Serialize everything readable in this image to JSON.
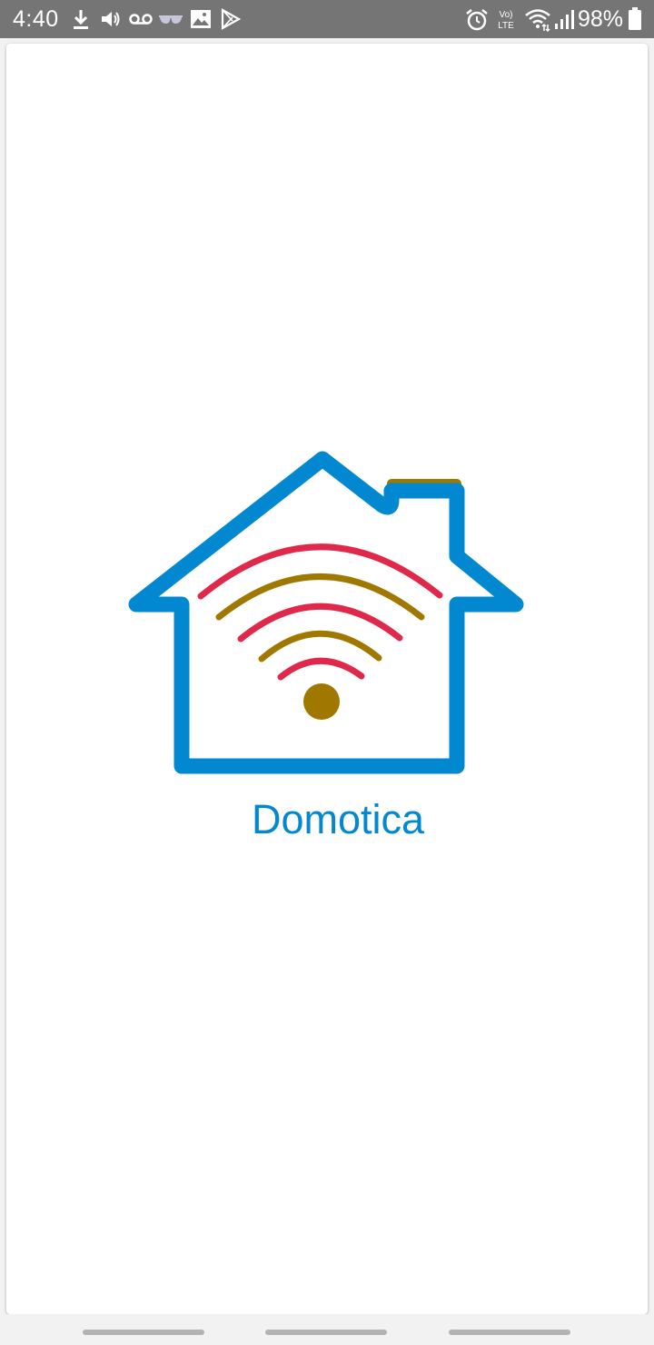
{
  "status_bar": {
    "time": "4:40",
    "battery_percent": "98%",
    "network_label": "Vo) LTE",
    "left_icons": [
      "download-icon",
      "volume-icon",
      "voicemail-icon",
      "glasses-icon",
      "image-icon",
      "play-store-icon"
    ],
    "right_icons": [
      "alarm-icon",
      "volte-icon",
      "wifi-icon",
      "signal-icon",
      "battery-icon"
    ]
  },
  "splash": {
    "title": "Domotica",
    "logo_icon": "smart-home-wifi-icon",
    "colors": {
      "house": "#0288d1",
      "chimney": "#a07800",
      "wave_red": "#e0294a",
      "wave_gold": "#a07800",
      "title": "#0288d1"
    }
  },
  "nav_bar": {
    "items": [
      "recent-apps",
      "home",
      "back"
    ]
  }
}
